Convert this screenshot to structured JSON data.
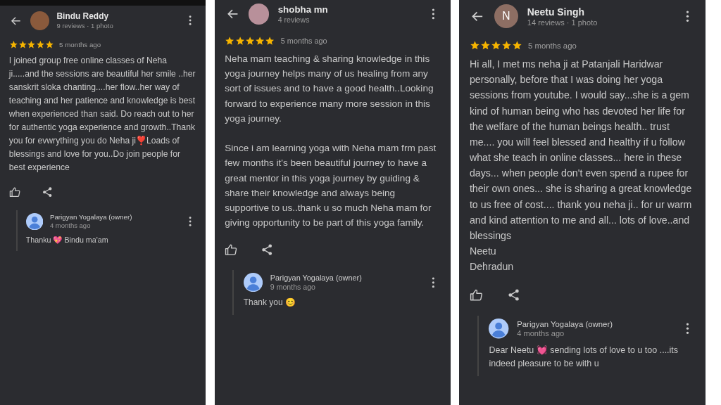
{
  "reviews": [
    {
      "reviewer": {
        "name": "Bindu Reddy",
        "meta": "9 reviews · 1 photo",
        "avatar": {
          "kind": "photo"
        }
      },
      "stars": 5,
      "time": "5 months ago",
      "paragraphs": [
        "I joined group free online classes of Neha ji.....and the sessions are beautiful her smile ..her sanskrit sloka chanting....her flow..her way of teaching and her patience and knowledge is best when experienced than said. Do reach out to her for authentic yoga experience and growth..Thank you for evwrything you do Neha ji❣️Loads of blessings and love for you..Do join people for best experience"
      ],
      "reply": {
        "name": "Parigyan Yogalaya (owner)",
        "time": "4 months ago",
        "text": "Thanku 💖 Bindu ma'am"
      }
    },
    {
      "reviewer": {
        "name": "shobha mn",
        "meta": "4 reviews",
        "avatar": {
          "kind": "photo"
        }
      },
      "stars": 5,
      "time": "5 months ago",
      "paragraphs": [
        "Neha mam teaching & sharing knowledge in this yoga journey helps many of us healing from any sort of issues and to have a good health..Looking forward to experience many more session in this yoga journey.",
        "Since i am learning yoga with Neha mam frm past few months it's been beautiful journey to have a great mentor in this yoga journey by guiding & share their knowledge and always being supportive to us..thank u so much Neha mam for giving opportunity to be part of this yoga family."
      ],
      "reply": {
        "name": "Parigyan Yogalaya (owner)",
        "time": "9 months ago",
        "text": "Thank you 😊"
      }
    },
    {
      "reviewer": {
        "name": "Neetu Singh",
        "meta": "14 reviews · 1 photo",
        "avatar": {
          "kind": "letter",
          "letter": "N"
        }
      },
      "stars": 5,
      "time": "5 months ago",
      "paragraphs": [
        "Hi all, I met ms neha ji at Patanjali Haridwar personally, before that I was doing her yoga sessions from youtube. I would say...she is a gem kind of human being who has devoted her life for the welfare of the human beings health.. trust me.... you will feel blessed and healthy if u follow what she teach in online classes... here in these days... when people don't even spend a rupee for their own ones... she is sharing a great knowledge to us free of cost.... thank you neha ji.. for ur warm and kind attention to me and all... lots of love..and blessings\nNeetu\nDehradun"
      ],
      "reply": {
        "name": "Parigyan Yogalaya (owner)",
        "time": "4 months ago",
        "text": "Dear Neetu 💓 sending lots of love to u too ....its indeed pleasure to be with u"
      }
    }
  ]
}
